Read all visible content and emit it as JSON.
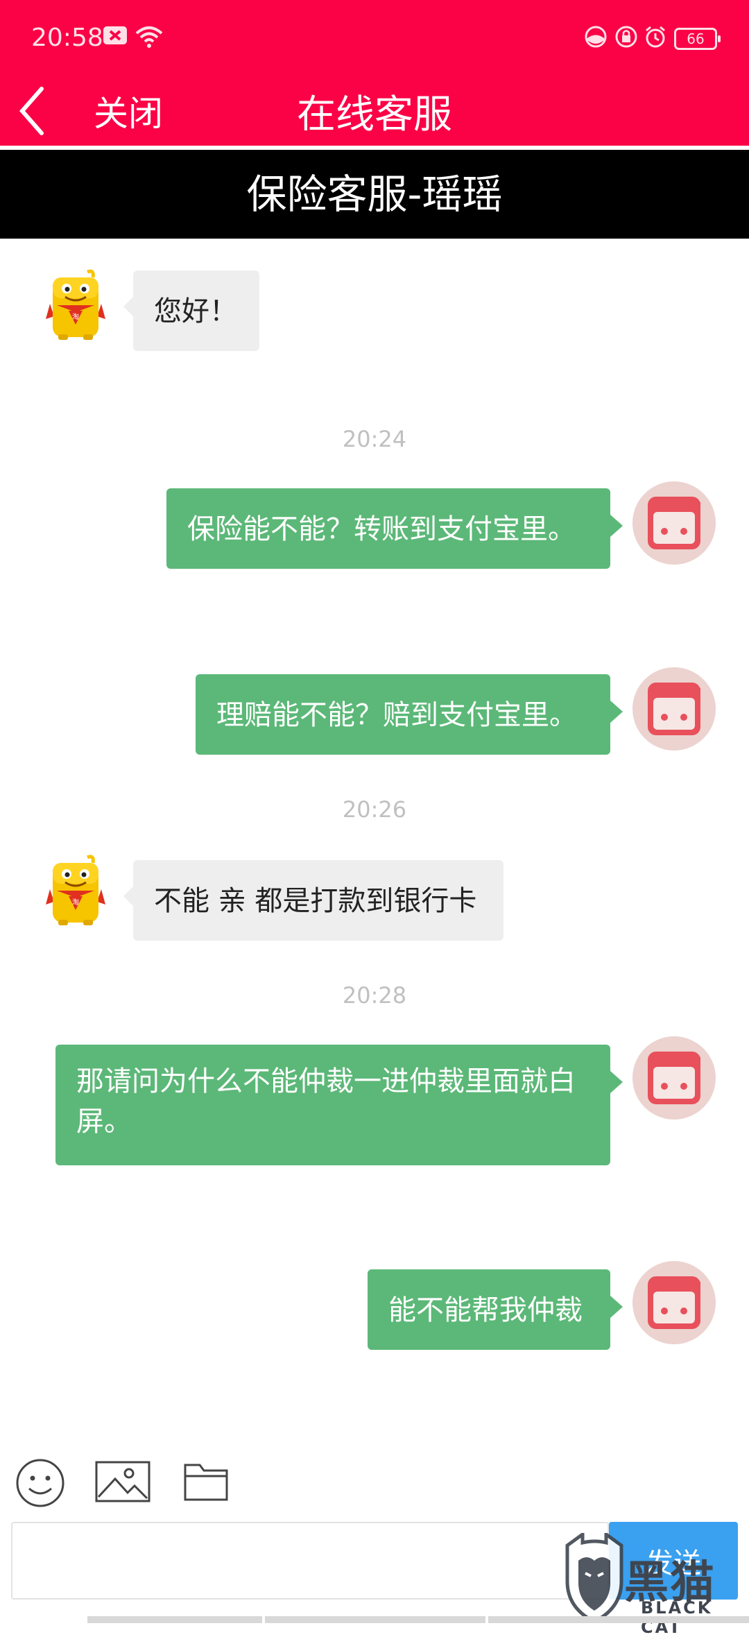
{
  "status": {
    "time": "20:58",
    "battery": "66"
  },
  "nav": {
    "close_label": "关闭",
    "title": "在线客服"
  },
  "agent": {
    "name": "保险客服-瑶瑶"
  },
  "messages": [
    {
      "from": "agent",
      "text": "您好！"
    },
    {
      "timestamp": "20:24"
    },
    {
      "from": "user",
      "text": "保险能不能？转账到支付宝里。"
    },
    {
      "from": "user",
      "text": "理赔能不能？赔到支付宝里。"
    },
    {
      "timestamp": "20:26"
    },
    {
      "from": "agent",
      "text": "不能 亲 都是打款到银行卡"
    },
    {
      "timestamp": "20:28"
    },
    {
      "from": "user",
      "text": "那请问为什么不能仲裁一进仲裁里面就白屏。"
    },
    {
      "from": "user",
      "text": "能不能帮我仲裁"
    }
  ],
  "input": {
    "placeholder": "",
    "send_label": "发送"
  },
  "watermark": {
    "cn": "黑猫",
    "en": "BLACK CAT"
  },
  "colors": {
    "header": "#fb0146",
    "agent_bar": "#000000",
    "user_bubble": "#5cb878",
    "agent_bubble": "#eeeeee",
    "send": "#3aa0f0"
  }
}
